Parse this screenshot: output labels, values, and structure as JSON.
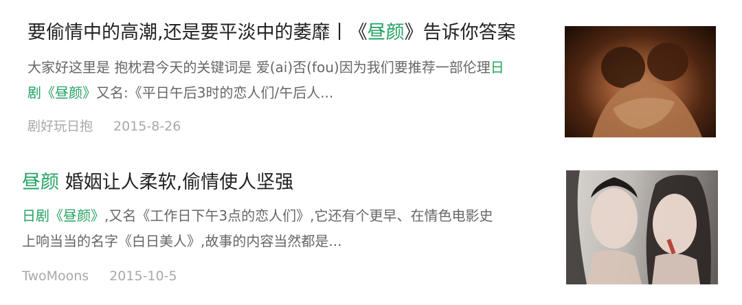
{
  "results": [
    {
      "title_pre": "要偷情中的高潮,还是要平淡中的萎靡丨《",
      "title_hl": "昼颜",
      "title_post": "》告诉你答案",
      "snippet_line1_pre": "大家好这里是 抱枕君今天的关键词是 爱(ai)否(fou)因为我们要推荐一部伦理",
      "snippet_line1_hl": "日",
      "snippet_line2_hl": "剧《昼颜》",
      "snippet_line2_post": "又名:《平日午后3时的恋人们/午后人...",
      "source": "剧好玩日抱",
      "date": "2015-8-26",
      "thumbnail_icon": "movie-still-couple"
    },
    {
      "title_hl": "昼颜",
      "title_post": " 婚姻让人柔软,偷情使人坚强",
      "snippet_line1_hl": "日剧《昼颜》",
      "snippet_line1_post": ",又名《工作日下午3点的恋人们》,它还有个更早、在情色电影史",
      "snippet_line2": "上响当当的名字《白日美人》,故事的内容当然都是...",
      "source": "TwoMoons",
      "date": "2015-10-5",
      "thumbnail_icon": "movie-poster-two-women"
    }
  ],
  "colors": {
    "highlight": "#21a261",
    "title": "#222222",
    "snippet": "#666666",
    "meta": "#a8a8a8"
  }
}
